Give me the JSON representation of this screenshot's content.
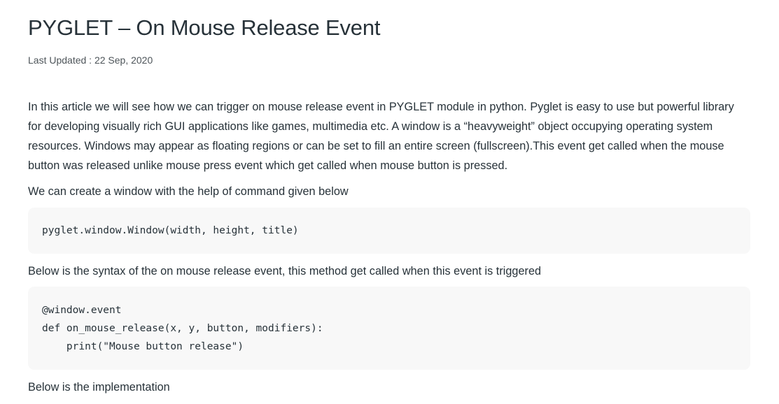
{
  "article": {
    "title": "PYGLET – On Mouse Release Event",
    "last_updated": "Last Updated : 22 Sep, 2020",
    "intro": "In this article we will see how we can trigger on mouse release event in PYGLET module in python. Pyglet is easy to use but powerful library for developing visually rich GUI applications like games, multimedia etc. A window is a “heavyweight” object occupying operating system resources. Windows may appear as floating regions or can be set to fill an entire screen (fullscreen).This event get called when the mouse button was released unlike mouse press event which get called when mouse button is pressed.",
    "para_create": "We can create a window with the help of command given below",
    "code_create": [
      "pyglet.window.Window(width, height, title)"
    ],
    "para_syntax": "Below is the syntax of the on mouse release event, this method get called when this event is triggered",
    "code_syntax": [
      "@window.event",
      "def on_mouse_release(x, y, button, modifiers):",
      "    print(\"Mouse button release\")"
    ],
    "para_impl": "Below is the implementation"
  }
}
